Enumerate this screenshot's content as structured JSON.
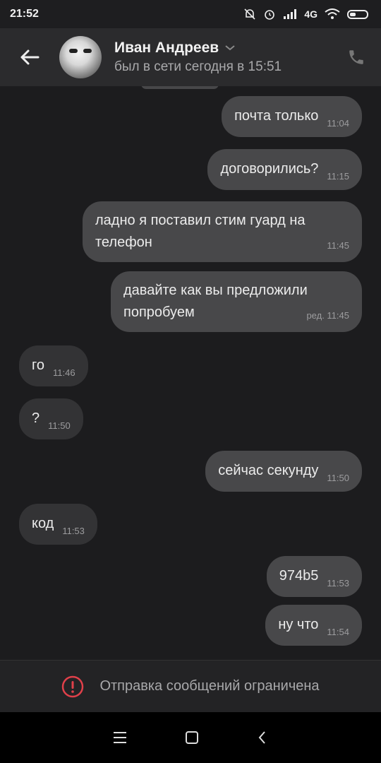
{
  "status_bar": {
    "time": "21:52",
    "network": "4G"
  },
  "header": {
    "name": "Иван Андреев",
    "last_seen": "был в сети сегодня в 15:51"
  },
  "messages": [
    {
      "text": "почта только",
      "time": "11:04",
      "direction": "out"
    },
    {
      "text": "договорились?",
      "time": "11:15",
      "direction": "out"
    },
    {
      "text": "ладно я поставил стим гуард на телефон",
      "time": "11:45",
      "direction": "out"
    },
    {
      "text": "давайте как вы предложили попробуем",
      "time": "ред. 11:45",
      "direction": "out"
    },
    {
      "text": "го",
      "time": "11:46",
      "direction": "in"
    },
    {
      "text": "?",
      "time": "11:50",
      "direction": "in"
    },
    {
      "text": "сейчас секунду",
      "time": "11:50",
      "direction": "out"
    },
    {
      "text": "код",
      "time": "11:53",
      "direction": "in"
    },
    {
      "text": "974b5",
      "time": "11:53",
      "direction": "out"
    },
    {
      "text": "ну что",
      "time": "11:54",
      "direction": "out"
    }
  ],
  "footer": {
    "restriction_text": "Отправка сообщений ограничена"
  },
  "colors": {
    "background": "#1c1c1e",
    "outgoing_bubble": "#48484a",
    "incoming_bubble": "#333335",
    "warning": "#e0404a"
  },
  "icons": [
    "back-arrow-icon",
    "chevron-down-icon",
    "phone-icon",
    "alert-icon",
    "menu-icon",
    "home-square-icon",
    "back-chevron-icon"
  ]
}
